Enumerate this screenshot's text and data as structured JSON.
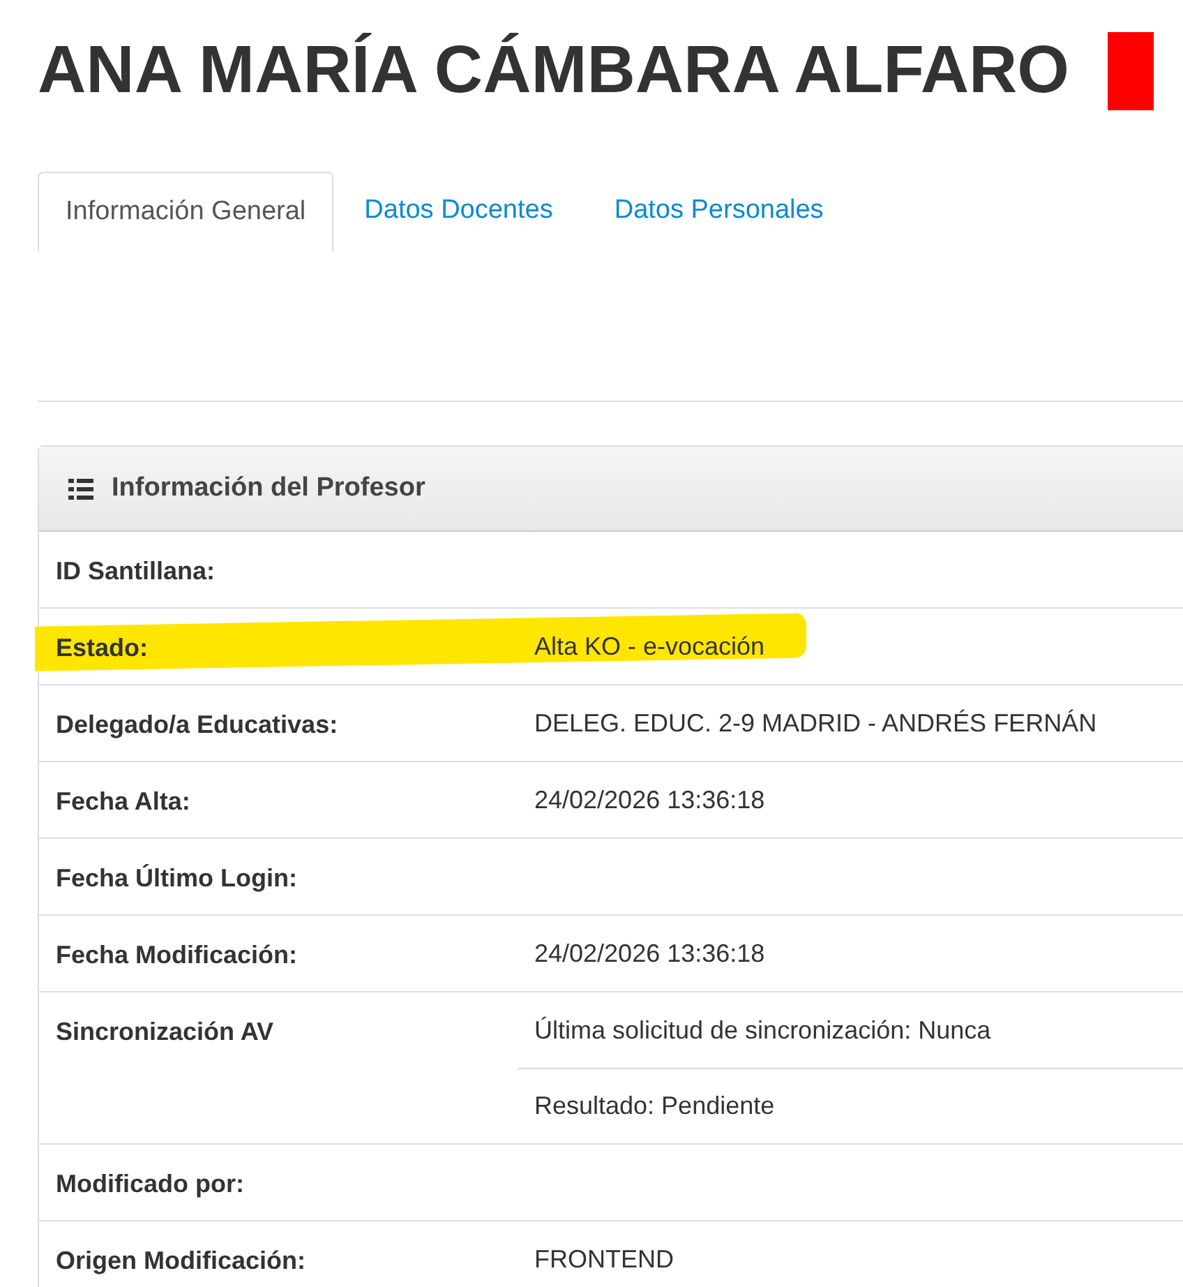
{
  "title": "ANA MARÍA CÁMBARA ALFARO",
  "tabs": [
    {
      "label": "Información General",
      "selected": true
    },
    {
      "label": "Datos Docentes",
      "selected": false
    },
    {
      "label": "Datos Personales",
      "selected": false
    }
  ],
  "panel": {
    "title": "Información del Profesor",
    "rows": [
      {
        "label": "ID Santillana:",
        "values": [],
        "highlighted": false
      },
      {
        "label": "Estado:",
        "values": [
          "Alta KO - e-vocación"
        ],
        "highlighted": true
      },
      {
        "label": "Delegado/a Educativas:",
        "values": [
          "DELEG. EDUC. 2-9 MADRID - ANDRÉS FERNÁN"
        ],
        "highlighted": false
      },
      {
        "label": "Fecha Alta:",
        "values": [
          "24/02/2026 13:36:18"
        ],
        "highlighted": false
      },
      {
        "label": "Fecha Último Login:",
        "values": [],
        "highlighted": false
      },
      {
        "label": "Fecha Modificación:",
        "values": [
          "24/02/2026 13:36:18"
        ],
        "highlighted": false
      },
      {
        "label": "Sincronización AV",
        "values": [
          "Última solicitud de sincronización: Nunca",
          "Resultado: Pendiente"
        ],
        "highlighted": false
      },
      {
        "label": "Modificado por:",
        "values": [],
        "highlighted": false
      },
      {
        "label": "Origen Modificación:",
        "values": [
          "FRONTEND"
        ],
        "highlighted": false
      }
    ]
  }
}
